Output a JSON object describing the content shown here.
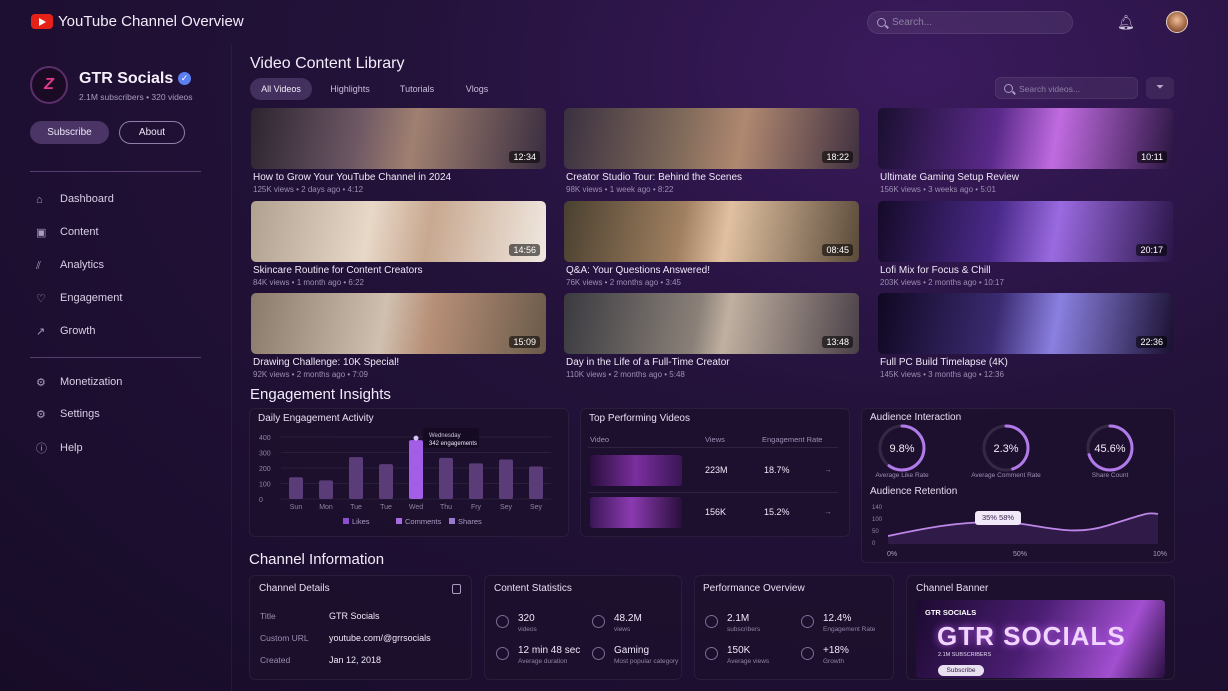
{
  "app": {
    "title": "YouTube Channel Overview",
    "search_placeholder": "Search..."
  },
  "channel": {
    "name": "GTR Socials",
    "stats": "2.1M subscribers • 320 videos",
    "logo_text": "Z",
    "subscribe": "Subscribe",
    "about": "About"
  },
  "nav": {
    "main": [
      "Dashboard",
      "Content",
      "Analytics",
      "Engagement",
      "Growth"
    ],
    "secondary": [
      "Monetization",
      "Settings",
      "Help"
    ]
  },
  "library": {
    "title": "Video Content Library",
    "tabs": [
      "All Videos",
      "Highlights",
      "Tutorials",
      "Vlogs"
    ],
    "search_placeholder": "Search videos...",
    "videos": [
      {
        "title": "How to Grow Your YouTube Channel in 2024",
        "meta": "125K views • 2 days ago • 4:12",
        "duration": "12:34"
      },
      {
        "title": "Creator Studio Tour: Behind the Scenes",
        "meta": "98K views • 1 week ago • 8:22",
        "duration": "18:22"
      },
      {
        "title": "Ultimate Gaming Setup Review",
        "meta": "156K views • 3 weeks ago • 5:01",
        "duration": "10:11"
      },
      {
        "title": "Skincare Routine for Content Creators",
        "meta": "84K views • 1 month ago • 6:22",
        "duration": "14:56"
      },
      {
        "title": "Q&A: Your Questions Answered!",
        "meta": "76K views • 2 months ago • 3:45",
        "duration": "08:45"
      },
      {
        "title": "Lofi Mix for Focus & Chill",
        "meta": "203K views • 2 months ago • 10:17",
        "duration": "20:17"
      },
      {
        "title": "Drawing Challenge: 10K Special!",
        "meta": "92K views • 2 months ago • 7:09",
        "duration": "15:09"
      },
      {
        "title": "Day in the Life of a Full-Time Creator",
        "meta": "110K views • 2 months ago • 5:48",
        "duration": "13:48"
      },
      {
        "title": "Full PC Build Timelapse (4K)",
        "meta": "145K views • 3 months ago • 12:36",
        "duration": "22:36"
      }
    ]
  },
  "insights": {
    "title": "Engagement Insights",
    "daily_title": "Daily Engagement Activity",
    "tooltip": {
      "day": "Wednesday",
      "value": "342 engagements"
    },
    "legend": [
      "Likes",
      "Comments",
      "Shares"
    ],
    "top_title": "Top Performing Videos",
    "top_headers": [
      "Video",
      "Views",
      "Engagement Rate"
    ],
    "top_rows": [
      {
        "views": "223M",
        "rate": "18.7%"
      },
      {
        "views": "156K",
        "rate": "15.2%"
      }
    ],
    "audience_title": "Audience Interaction",
    "gauges": [
      {
        "value": "9.8%",
        "label": "Average Like Rate",
        "pct": 0.6
      },
      {
        "value": "2.3%",
        "label": "Average Comment Rate",
        "pct": 0.45
      },
      {
        "value": "45.6%",
        "label": "Share Count",
        "pct": 0.7
      }
    ],
    "retention_title": "Audience Retention",
    "retention_tip": "35%  58%",
    "retention_ticks": [
      "0%",
      "50%",
      "10%"
    ],
    "retention_y": [
      "140",
      "100",
      "50",
      "0"
    ]
  },
  "chart_data": {
    "type": "bar",
    "title": "Daily Engagement Activity",
    "categories": [
      "Sun",
      "Mon",
      "Tue",
      "Tue",
      "Wed",
      "Thu",
      "Fry",
      "Sey",
      "Sey"
    ],
    "values": [
      140,
      120,
      270,
      225,
      380,
      265,
      230,
      255,
      210
    ],
    "ylim": [
      0,
      400
    ],
    "yticks": [
      "400",
      "300",
      "200",
      "100",
      "0"
    ],
    "highlight_index": 4
  },
  "info": {
    "title": "Channel Information",
    "details_title": "Channel Details",
    "details": [
      {
        "k": "Title",
        "v": "GTR Socials"
      },
      {
        "k": "Custom URL",
        "v": "youtube.com/@grrsocials"
      },
      {
        "k": "Created",
        "v": "Jan 12, 2018"
      }
    ],
    "content_title": "Content Statistics",
    "content_stats": [
      {
        "v": "320",
        "l": "videos"
      },
      {
        "v": "48.2M",
        "l": "views"
      },
      {
        "v": "12 min 48 sec",
        "l": "Average duration"
      },
      {
        "v": "Gaming",
        "l": "Most popular category"
      }
    ],
    "perf_title": "Performance Overview",
    "perf_stats": [
      {
        "v": "2.1M",
        "l": "subscribers"
      },
      {
        "v": "12.4%",
        "l": "Engagement Rate"
      },
      {
        "v": "150K",
        "l": "Average views"
      },
      {
        "v": "+18%",
        "l": "Growth"
      }
    ],
    "banner_title": "Channel Banner",
    "banner": {
      "brand": "GTR SOCIALS",
      "big": "GTR SOCIALS",
      "subs": "2.1M SUBSCRIBERS",
      "btn": "Subscribe"
    }
  }
}
